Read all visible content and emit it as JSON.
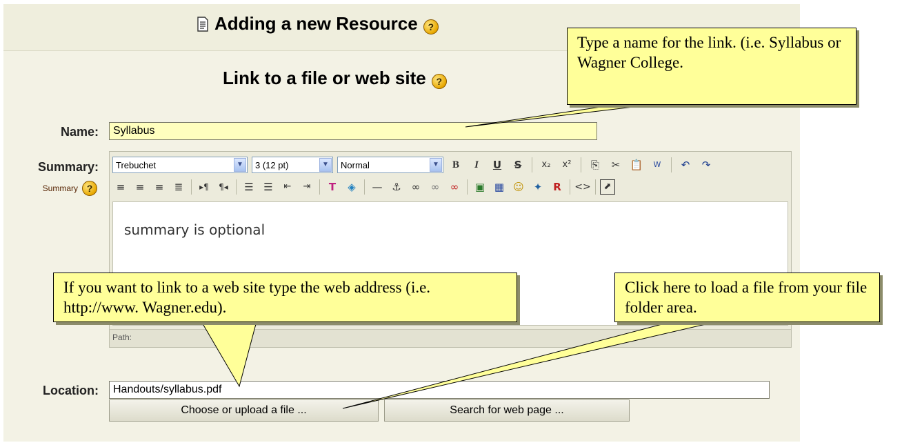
{
  "header": {
    "page_title": "Adding a new Resource",
    "section_title": "Link to a file or web site"
  },
  "form": {
    "name_label": "Name:",
    "name_value": "Syllabus",
    "summary_label": "Summary:",
    "summary_sub": "Summary",
    "location_label": "Location:",
    "location_value": "Handouts/syllabus.pdf",
    "choose_button": "Choose or upload a file ...",
    "search_button": "Search for web page ..."
  },
  "editor": {
    "font_select": "Trebuchet",
    "size_select": "3 (12 pt)",
    "format_select": "Normal",
    "content": "summary is optional",
    "path": "Path:"
  },
  "callouts": {
    "name_tip": "Type a name for the link. (i.e. Syllabus or Wagner College.",
    "web_tip": "If you want to link to a web site type the web address (i.e. http://www. Wagner.edu).",
    "file_tip": "Click here to load a file from your file folder area."
  },
  "colors": {
    "callout_bg": "#ffff99",
    "panel_bg": "#f3f2e5",
    "name_input_bg": "#ffffbe"
  }
}
